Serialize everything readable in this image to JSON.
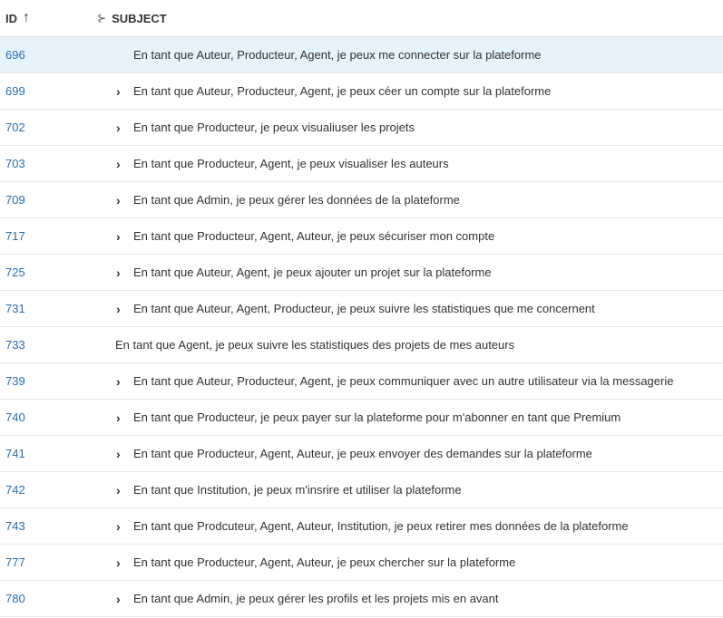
{
  "header": {
    "id_label": "ID",
    "sort_glyph": "↑",
    "hierarchy_glyph": "⊱",
    "subject_label": "SUBJECT"
  },
  "colors": {
    "link": "#2a6ead",
    "selected_row": "#e6f3fc",
    "border": "#e3e6ea"
  },
  "rows": [
    {
      "id": "696",
      "subject": "En tant que Auteur, Producteur, Agent, je peux me connecter sur la plateforme",
      "expander": ""
    },
    {
      "id": "699",
      "subject": "En tant que Auteur, Producteur, Agent, je peux céer un compte sur la plateforme",
      "expander": "›"
    },
    {
      "id": "702",
      "subject": "En tant que Producteur, je peux visualiuser les projets",
      "expander": "›"
    },
    {
      "id": "703",
      "subject": "En tant que Producteur, Agent, je peux visualiser les auteurs",
      "expander": "›"
    },
    {
      "id": "709",
      "subject": "En tant que Admin, je peux gérer les données de la plateforme",
      "expander": "›"
    },
    {
      "id": "717",
      "subject": "En tant que Producteur, Agent, Auteur, je peux sécuriser mon compte",
      "expander": "›"
    },
    {
      "id": "725",
      "subject": "En tant que Auteur, Agent, je peux ajouter un projet sur la plateforme",
      "expander": "›"
    },
    {
      "id": "731",
      "subject": "En tant que Auteur, Agent, Producteur, je peux suivre les statistiques que me concernent",
      "expander": "›"
    },
    {
      "id": "733",
      "subject": "En tant que Agent, je peux suivre les statistiques des projets de mes auteurs",
      "expander": ""
    },
    {
      "id": "739",
      "subject": "En tant que Auteur, Producteur, Agent, je peux communiquer avec un autre utilisateur via la messagerie",
      "expander": "›"
    },
    {
      "id": "740",
      "subject": "En tant que Producteur, je peux payer sur la plateforme pour m'abonner en tant que Premium",
      "expander": "›"
    },
    {
      "id": "741",
      "subject": "En tant que Producteur, Agent, Auteur, je peux envoyer des demandes sur la plateforme",
      "expander": "›"
    },
    {
      "id": "742",
      "subject": "En tant que Institution, je peux m'insrire et utiliser la plateforme",
      "expander": "›"
    },
    {
      "id": "743",
      "subject": "En tant que Prodcuteur, Agent, Auteur, Institution, je peux retirer mes données de la plateforme",
      "expander": "›"
    },
    {
      "id": "777",
      "subject": "En tant que Producteur, Agent, Auteur, je peux chercher sur la plateforme",
      "expander": "›"
    },
    {
      "id": "780",
      "subject": "En tant que Admin, je peux gérer les profils et les projets mis en avant",
      "expander": "›"
    }
  ]
}
